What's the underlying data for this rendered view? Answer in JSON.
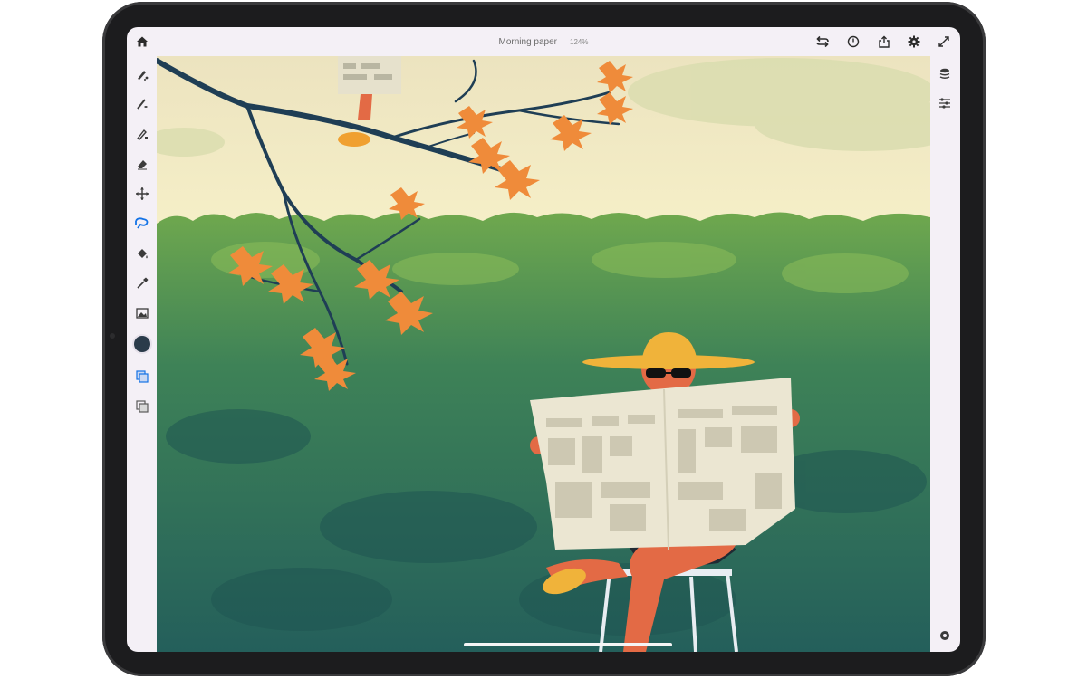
{
  "document": {
    "title": "Morning paper",
    "zoom": "124%"
  },
  "toolbar": {
    "home": "home-icon",
    "right_icons": [
      "undo-redo-icon",
      "history-icon",
      "share-icon",
      "settings-icon",
      "fullscreen-icon"
    ]
  },
  "tools": [
    "pixel-brush",
    "live-brush",
    "vector-brush",
    "eraser",
    "move-transform",
    "lasso-selection",
    "fill",
    "eyedropper",
    "image-import"
  ],
  "active_tool": "lasso-selection",
  "current_color": "#2a3b4a",
  "right_panel": [
    "layers-icon",
    "layer-properties-icon"
  ],
  "bottom_icon": "touch-shortcut-icon",
  "colors": {
    "sky": "#f3ecc6",
    "hedge": "#2c6a64",
    "leaves": "#ef8b3a",
    "hat": "#f0b33a",
    "skin": "#e36a45"
  }
}
